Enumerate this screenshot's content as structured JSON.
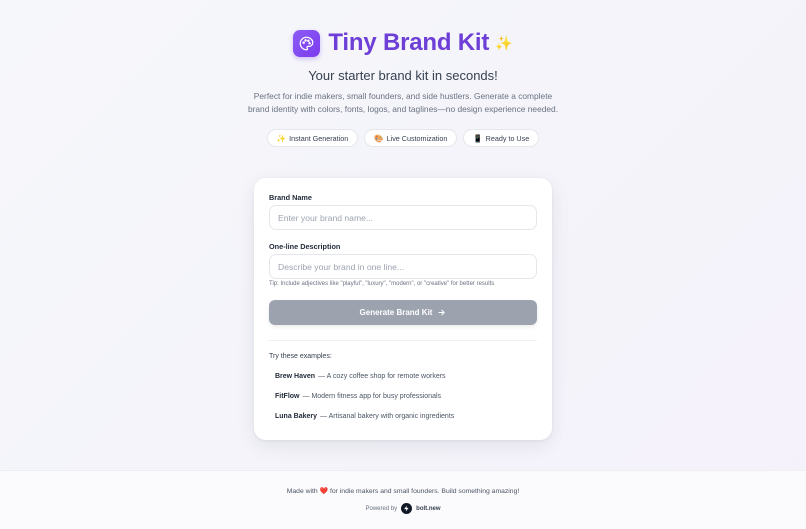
{
  "header": {
    "title": "Tiny Brand Kit",
    "sparkle": "✨",
    "subtitle": "Your starter brand kit in seconds!",
    "description": "Perfect for indie makers, small founders, and side hustlers. Generate a complete brand identity with colors, fonts, logos, and taglines—no design experience needed.",
    "logo_icon": "palette-icon"
  },
  "features": [
    {
      "icon": "✨",
      "label": "Instant Generation"
    },
    {
      "icon": "🎨",
      "label": "Live Customization"
    },
    {
      "icon": "📱",
      "label": "Ready to Use"
    }
  ],
  "form": {
    "brand_name_label": "Brand Name",
    "brand_name_placeholder": "Enter your brand name...",
    "brand_name_value": "",
    "description_label": "One-line Description",
    "description_placeholder": "Describe your brand in one line...",
    "description_value": "",
    "tip": "Tip: Include adjectives like \"playful\", \"luxury\", \"modern\", or \"creative\" for better results",
    "generate_label": "Generate Brand Kit",
    "generate_icon": "arrow-right-icon"
  },
  "examples": {
    "title": "Try these examples:",
    "items": [
      {
        "name": "Brew Haven",
        "desc": "— A cozy coffee shop for remote workers"
      },
      {
        "name": "FitFlow",
        "desc": "— Modern fitness app for busy professionals"
      },
      {
        "name": "Luna Bakery",
        "desc": "— Artisanal bakery with organic ingredients"
      }
    ]
  },
  "footer": {
    "made_with_prefix": "Made with",
    "heart": "❤️",
    "made_with_suffix": "for indie makers and small founders. Build something amazing!",
    "powered_by": "Powered by",
    "powered_name": "bolt.new"
  },
  "colors": {
    "brand": "#7c3aed",
    "title": "#6d3fd6",
    "button_disabled": "#9ca3af"
  }
}
